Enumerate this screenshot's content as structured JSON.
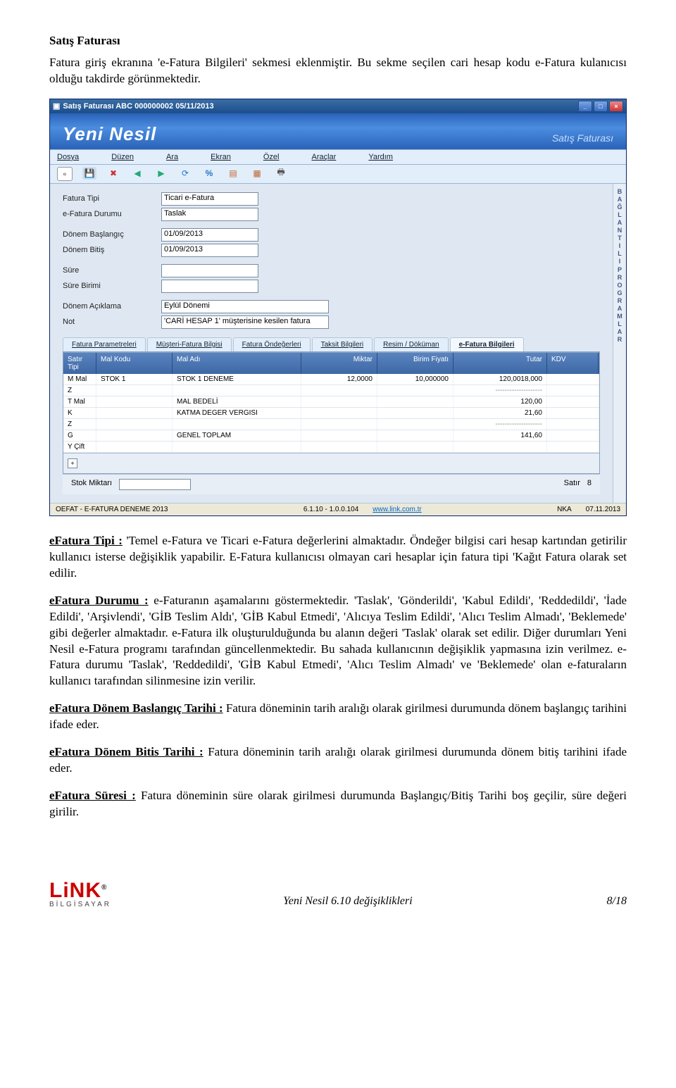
{
  "doc": {
    "title": "Satış Faturası",
    "intro": "Fatura giriş ekranına 'e-Fatura Bilgileri' sekmesi eklenmiştir. Bu sekme seçilen cari hesap kodu e-Fatura kulanıcısı olduğu takdirde görünmektedir.",
    "p_tipi_label": "eFatura Tipi :",
    "p_tipi": " 'Temel e-Fatura ve Ticari e-Fatura değerlerini almaktadır. Öndeğer bilgisi cari hesap kartından getirilir kullanıcı isterse değişiklik yapabilir. E-Fatura kullanıcısı olmayan cari hesaplar için fatura tipi 'Kağıt Fatura olarak set edilir.",
    "p_durumu_label": "eFatura Durumu :",
    "p_durumu": " e-Faturanın aşamalarını göstermektedir. 'Taslak', 'Gönderildi', 'Kabul Edildi', 'Reddedildi', 'İade Edildi', 'Arşivlendi', 'GİB Teslim Aldı', 'GİB Kabul Etmedi', 'Alıcıya Teslim Edildi', 'Alıcı Teslim Almadı', 'Beklemede' gibi değerler almaktadır. e-Fatura ilk oluşturulduğunda bu alanın değeri 'Taslak' olarak set edilir. Diğer durumları Yeni Nesil e-Fatura programı tarafından güncellenmektedir. Bu sahada kullanıcının değişiklik yapmasına izin verilmez. e-Fatura durumu 'Taslak', 'Reddedildi', 'GİB Kabul Etmedi', 'Alıcı Teslim Almadı' ve 'Beklemede' olan e-faturaların kullanıcı tarafından silinmesine izin verilir.",
    "p_bas_label": "eFatura Dönem Baslangıç Tarihi :",
    "p_bas": " Fatura döneminin tarih aralığı olarak girilmesi durumunda dönem başlangıç tarihini ifade eder.",
    "p_bit_label": "eFatura Dönem Bitis Tarihi :",
    "p_bit": " Fatura döneminin tarih aralığı olarak girilmesi durumunda dönem bitiş tarihini ifade eder.",
    "p_sure_label": "eFatura Süresi :",
    "p_sure": " Fatura döneminin süre olarak girilmesi durumunda Başlangıç/Bitiş Tarihi boş geçilir, süre değeri girilir."
  },
  "win": {
    "title": "Satış Faturası  ABC 000000002 05/11/2013",
    "app_name": "Yeni Nesil",
    "crumb": "Satış Faturası",
    "menu": [
      "Dosya",
      "Düzen",
      "Ara",
      "Ekran",
      "Özel",
      "Araçlar",
      "Yardım"
    ],
    "form": {
      "fatura_tipi_lbl": "Fatura Tipi",
      "fatura_tipi": "Ticari e-Fatura",
      "efatura_durumu_lbl": "e-Fatura Durumu",
      "efatura_durumu": "Taslak",
      "donem_bas_lbl": "Dönem Başlangıç",
      "donem_bas": "01/09/2013",
      "donem_bit_lbl": "Dönem Bitiş",
      "donem_bit": "01/09/2013",
      "sure_lbl": "Süre",
      "sure": "",
      "sure_birimi_lbl": "Süre Birimi",
      "sure_birimi": "",
      "donem_aciklama_lbl": "Dönem Açıklama",
      "donem_aciklama": "Eylül Dönemi",
      "not_lbl": "Not",
      "not": "'CARİ HESAP 1' müşterisine kesilen fatura"
    },
    "tabs": [
      "Fatura Parametreleri",
      "Müşteri-Fatura Bilgisi",
      "Fatura Öndeğerleri",
      "Taksit Bilgileri",
      "Resim / Döküman",
      "e-Fatura Bilgileri"
    ],
    "grid_head": [
      "Satır Tipi",
      "Mal Kodu",
      "Mal Adı",
      "Miktar",
      "Birim Fiyatı",
      "Tutar",
      "KDV"
    ],
    "rows": [
      {
        "t": "M Mal",
        "kod": "STOK 1",
        "ad": "STOK 1 DENEME",
        "mik": "12,0000",
        "bf": "10,000000",
        "tut": "120,0018,000",
        "kdv": ""
      },
      {
        "t": "Z",
        "kod": "",
        "ad": "",
        "mik": "",
        "bf": "",
        "tut": "--------------------",
        "kdv": ""
      },
      {
        "t": "T Mal",
        "kod": "",
        "ad": "MAL BEDELİ",
        "mik": "",
        "bf": "",
        "tut": "120,00",
        "kdv": ""
      },
      {
        "t": "K",
        "kod": "",
        "ad": "KATMA DEGER VERGISI",
        "mik": "",
        "bf": "",
        "tut": "21,60",
        "kdv": ""
      },
      {
        "t": "Z",
        "kod": "",
        "ad": "",
        "mik": "",
        "bf": "",
        "tut": "--------------------",
        "kdv": ""
      },
      {
        "t": "G",
        "kod": "",
        "ad": "GENEL TOPLAM",
        "mik": "",
        "bf": "",
        "tut": "141,60",
        "kdv": ""
      },
      {
        "t": "Y Çift",
        "kod": "",
        "ad": "",
        "mik": "",
        "bf": "",
        "tut": "",
        "kdv": ""
      }
    ],
    "stok_lbl": "Stok Miktarı",
    "satir_lbl": "Satır",
    "satir_val": "8",
    "status": {
      "oefat": "OEFAT - E-FATURA DENEME 2013",
      "ver": "6.1.10 - 1.0.0.104",
      "link": "www.link.com.tr",
      "nka": "NKA",
      "date": "07.11.2013"
    },
    "side": [
      "B",
      "A",
      "Ğ",
      "L",
      "A",
      "N",
      "T",
      "I",
      "L",
      "I",
      "",
      "P",
      "R",
      "O",
      "G",
      "R",
      "A",
      "M",
      "L",
      "A",
      "R"
    ]
  },
  "footer": {
    "brand": "LiNK",
    "brand_sub": "BİLGİSAYAR",
    "center": "Yeni Nesil 6.10 değişiklikleri",
    "page": "8/18"
  }
}
